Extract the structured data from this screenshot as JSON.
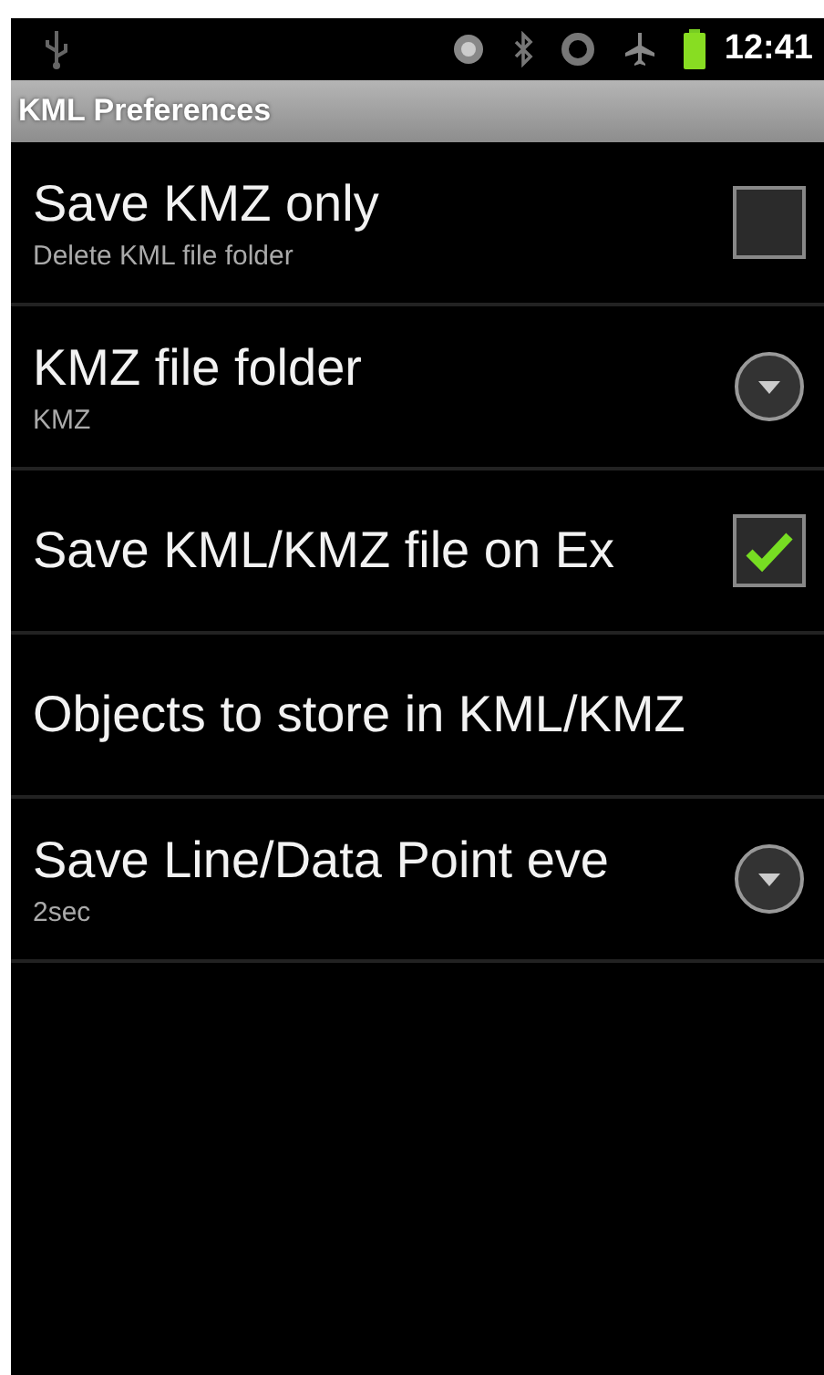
{
  "status_bar": {
    "time": "12:41"
  },
  "title_bar": {
    "title": "KML Preferences"
  },
  "preferences": [
    {
      "kind": "checkbox",
      "title": "Save KMZ only",
      "summary": "Delete KML file folder",
      "checked": false
    },
    {
      "kind": "list",
      "title": "KMZ file folder",
      "summary": "KMZ"
    },
    {
      "kind": "checkbox",
      "title": "Save KML/KMZ file on Ex",
      "checked": true
    },
    {
      "kind": "screen",
      "title": "Objects to store in KML/KMZ"
    },
    {
      "kind": "list",
      "title": "Save Line/Data Point eve",
      "summary": "2sec"
    }
  ]
}
